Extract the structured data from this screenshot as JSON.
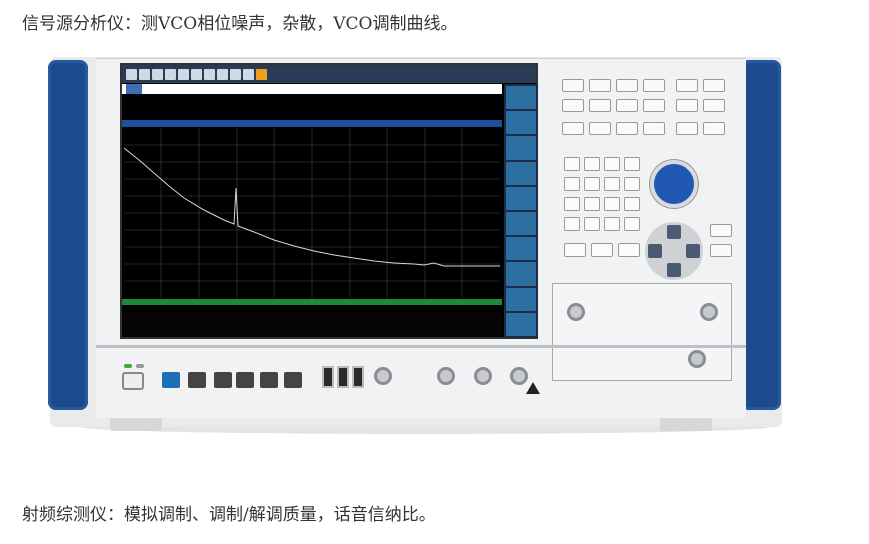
{
  "captions": {
    "top": "信号源分析仪：测VCO相位噪声，杂散，VCO调制曲线。",
    "bottom": "射频综测仪：模拟调制、调制/解调质量，话音信纳比。"
  },
  "colors": {
    "side_panel": "#1d4a8c",
    "knob": "#1f57b3",
    "screen_bg": "#000000",
    "trace_grid": "#2f4f2f",
    "trace_line": "#d8d8d8"
  }
}
